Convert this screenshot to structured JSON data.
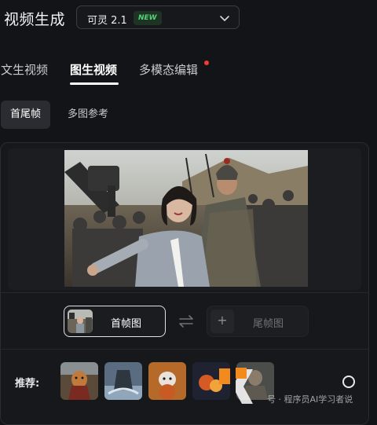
{
  "header": {
    "title": "视频生成",
    "model_select": {
      "value": "可灵 2.1",
      "badge": "NEW"
    }
  },
  "tabs": [
    {
      "label": "文生视频",
      "active": false
    },
    {
      "label": "图生视频",
      "active": true
    },
    {
      "label": "多模态编辑",
      "active": false,
      "has_notification_dot": true
    }
  ],
  "subtabs": [
    {
      "label": "首尾帧",
      "active": true
    },
    {
      "label": "多图参考",
      "active": false
    }
  ],
  "frames": {
    "start_label": "首帧图",
    "end_label": "尾帧图",
    "plus_glyph": "+"
  },
  "recommend": {
    "label": "推荐:",
    "items": [
      "armored-dog",
      "water-mecha",
      "red-panda",
      "fire-scene",
      "armor-figure"
    ]
  },
  "watermark": {
    "text": "号 · 程序员AI学习者说"
  },
  "icons": {
    "chevron": "chevron-down-icon",
    "swap": "swap-icon",
    "plus": "plus-icon"
  },
  "colors": {
    "accent_green": "#52d47a",
    "notification_red": "#f03b3b",
    "watermark_orange": "#f28a1e"
  }
}
